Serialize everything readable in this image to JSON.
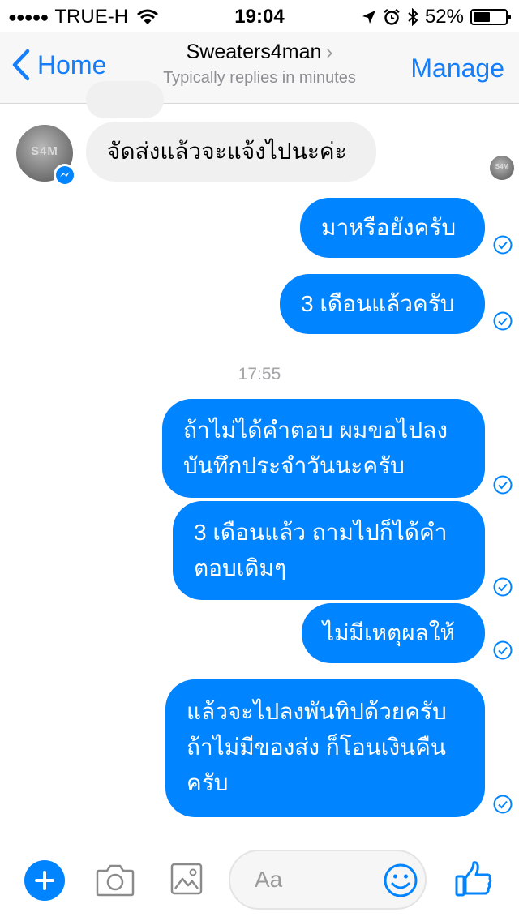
{
  "status_bar": {
    "carrier": "TRUE-H",
    "time": "19:04",
    "battery": "52%",
    "battery_level": 0.52
  },
  "header": {
    "back_label": "Home",
    "title": "Sweaters4man",
    "subtitle": "Typically replies in minutes",
    "manage_label": "Manage"
  },
  "avatar_text": "S4M",
  "messages": [
    {
      "text": "จัดส่งแล้วจะแจ้งไปนะค่ะ",
      "direction": "incoming"
    },
    {
      "text": "มาหรือยังครับ",
      "direction": "outgoing"
    },
    {
      "text": "3 เดือนแล้วครับ",
      "direction": "outgoing"
    },
    {
      "text": "ถ้าไม่ได้คำตอบ ผมขอไปลง\nบันทึกประจำวันนะครับ",
      "direction": "outgoing"
    },
    {
      "text": "3 เดือนแล้ว ถามไปก็ได้คำ\nตอบเดิมๆ",
      "direction": "outgoing"
    },
    {
      "text": "ไม่มีเหตุผลให้",
      "direction": "outgoing"
    },
    {
      "text": "แล้วจะไปลงพันทิปด้วยครับ\nถ้าไม่มีของส่ง ก็โอนเงินคืน\nครับ",
      "direction": "outgoing"
    }
  ],
  "timestamp": "17:55",
  "composer": {
    "placeholder": "Aa"
  },
  "colors": {
    "accent": "#0084ff",
    "nav_link": "#157efb",
    "incoming_bubble": "#f1f0f0"
  },
  "icons": [
    "location-arrow-icon",
    "alarm-icon",
    "bluetooth-icon",
    "wifi-icon",
    "camera-icon",
    "gallery-icon",
    "emoji-icon",
    "thumbs-up-icon",
    "check-circle-icon",
    "messenger-badge-icon"
  ]
}
